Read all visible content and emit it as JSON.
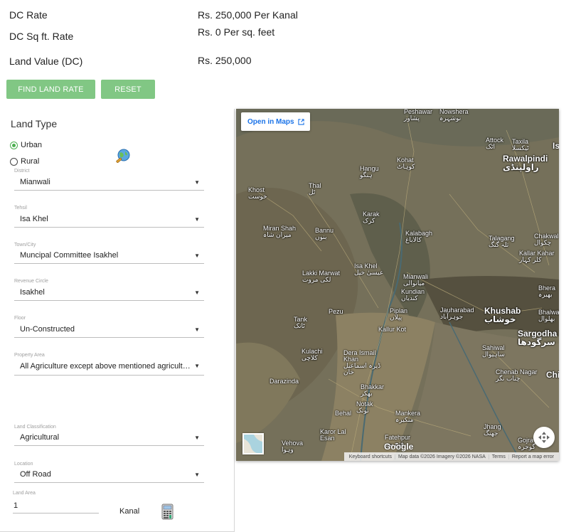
{
  "summary": {
    "dc_rate_label": "DC Rate",
    "dc_rate_value": "Rs. 250,000 Per Kanal",
    "dc_sqft_label": "DC Sq ft. Rate",
    "dc_sqft_value": "Rs. 0 Per sq. feet",
    "land_value_label": "Land Value (DC)",
    "land_value_value": "Rs. 250,000"
  },
  "buttons": {
    "find": "FIND LAND RATE",
    "reset": "RESET"
  },
  "form": {
    "title": "Land Type",
    "radio_urban": "Urban",
    "radio_rural": "Rural",
    "selected_land_type": "Urban",
    "district_label": "District",
    "district_value": "Mianwali",
    "tehsil_label": "Tehsil",
    "tehsil_value": "Isa Khel",
    "town_label": "Town/City",
    "town_value": "Muncipal Committee Isakhel",
    "revenue_label": "Revenue Circle",
    "revenue_value": "Isakhel",
    "floor_label": "Floor",
    "floor_value": "Un-Constructed",
    "property_label": "Property Area",
    "property_value": "All Agriculture except above mentioned agricultural",
    "classification_label": "Land Classification",
    "classification_value": "Agricultural",
    "location_label": "Location",
    "location_value": "Off Road",
    "area_label": "Land Area",
    "area_value": "1",
    "unit": "Kanal"
  },
  "map": {
    "open_in_maps": "Open in Maps",
    "google": "Google",
    "attribution": [
      "Keyboard shortcuts",
      "Map data ©2026 Imagery ©2026 NASA",
      "Terms",
      "Report a map error"
    ],
    "cities": [
      {
        "name": "Peshawar",
        "ur": "پشاور"
      },
      {
        "name": "Nowshera",
        "ur": "نوشہرہ"
      },
      {
        "name": "Attock",
        "ur": "اٹک"
      },
      {
        "name": "Taxila",
        "ur": "ٹیکسلا"
      },
      {
        "name": "Rawalpindi",
        "ur": "راولپنڈی"
      },
      {
        "name": "Kohat",
        "ur": "کوہاٹ"
      },
      {
        "name": "Hangu",
        "ur": "ہنگو"
      },
      {
        "name": "Khost",
        "ur": "خوست"
      },
      {
        "name": "Thal",
        "ur": "ٹل"
      },
      {
        "name": "Karak",
        "ur": "کرک"
      },
      {
        "name": "Miran Shah",
        "ur": "میران شاہ"
      },
      {
        "name": "Bannu",
        "ur": "بنوں"
      },
      {
        "name": "Kalabagh",
        "ur": "کالاباغ"
      },
      {
        "name": "Talagang",
        "ur": "تلہ گنگ"
      },
      {
        "name": "Chakwal",
        "ur": "چکوال"
      },
      {
        "name": "Kallar Kahar",
        "ur": "کلر کہار"
      },
      {
        "name": "Lakki Marwat",
        "ur": "لکی مروت"
      },
      {
        "name": "Isa Khel",
        "ur": "عیسیٰ خیل"
      },
      {
        "name": "Mianwali",
        "ur": "میانوالی"
      },
      {
        "name": "Kundian",
        "ur": "کندیاں"
      },
      {
        "name": "Bhera",
        "ur": "بھیرہ"
      },
      {
        "name": "Tank",
        "ur": "ٹانک"
      },
      {
        "name": "Pezu",
        "ur": ""
      },
      {
        "name": "Piplan",
        "ur": "پپلاں"
      },
      {
        "name": "Jauharabad",
        "ur": "جوہرآباد"
      },
      {
        "name": "Khushab",
        "ur": "خوشاب"
      },
      {
        "name": "Bhalwal",
        "ur": "بھلوال"
      },
      {
        "name": "Kallur Kot",
        "ur": ""
      },
      {
        "name": "Sargodha",
        "ur": "سرگودھا"
      },
      {
        "name": "Kulachi",
        "ur": "کلاچی"
      },
      {
        "name": "Dera Ismail Khan",
        "ur": "ڈیرہ اسماعیل خان"
      },
      {
        "name": "Sahiwal",
        "ur": "ساہیوال"
      },
      {
        "name": "Darazinda",
        "ur": ""
      },
      {
        "name": "Bhakkar",
        "ur": "بھکر"
      },
      {
        "name": "Chenab Nagar",
        "ur": "چناب نگر"
      },
      {
        "name": "Chi",
        "ur": ""
      },
      {
        "name": "Notak",
        "ur": "نوتک"
      },
      {
        "name": "Behal",
        "ur": ""
      },
      {
        "name": "Mankera",
        "ur": "منکیرہ"
      },
      {
        "name": "Jhang",
        "ur": "جھنگ"
      },
      {
        "name": "Karor Lal Esan",
        "ur": ""
      },
      {
        "name": "Fatehpur",
        "ur": "فتح پور"
      },
      {
        "name": "Vehova",
        "ur": "وہوا"
      },
      {
        "name": "Gojra",
        "ur": "گوجرہ"
      },
      {
        "name": "Is",
        "ur": ""
      }
    ]
  }
}
